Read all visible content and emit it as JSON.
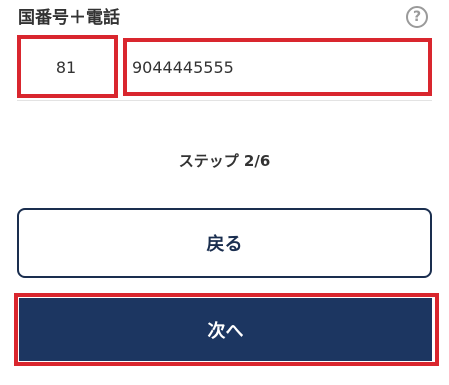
{
  "phone_section": {
    "label": "国番号＋電話",
    "help_icon": "?",
    "country_code": "81",
    "phone_number": "9044445555"
  },
  "step": {
    "text": "ステップ 2/6"
  },
  "buttons": {
    "back_label": "戻る",
    "next_label": "次へ"
  },
  "colors": {
    "highlight": "#d9262e",
    "primary_navy": "#1c3661",
    "border_navy": "#1a2e4f"
  }
}
